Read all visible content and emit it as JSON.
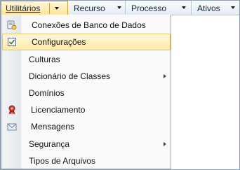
{
  "menubar": {
    "menus": [
      {
        "label": "Utilitários",
        "open": true
      },
      {
        "label": "Recurso"
      },
      {
        "label": "Processo"
      },
      {
        "label": "Ativos"
      }
    ]
  },
  "dropdown": {
    "items": [
      {
        "label": "Conexões de Banco de Dados",
        "icon": "database-connection-icon"
      },
      {
        "label": "Configurações",
        "icon": "checklist-icon",
        "highlighted": true
      },
      {
        "label": "Culturas"
      },
      {
        "label": "Dicionário de Classes",
        "submenu": true
      },
      {
        "label": "Domínios"
      },
      {
        "label": "Licenciamento",
        "icon": "award-ribbon-icon"
      },
      {
        "label": "Mensagens",
        "icon": "envelope-icon"
      },
      {
        "label": "Segurança",
        "submenu": true
      },
      {
        "label": "Tipos de Arquivos"
      }
    ]
  }
}
